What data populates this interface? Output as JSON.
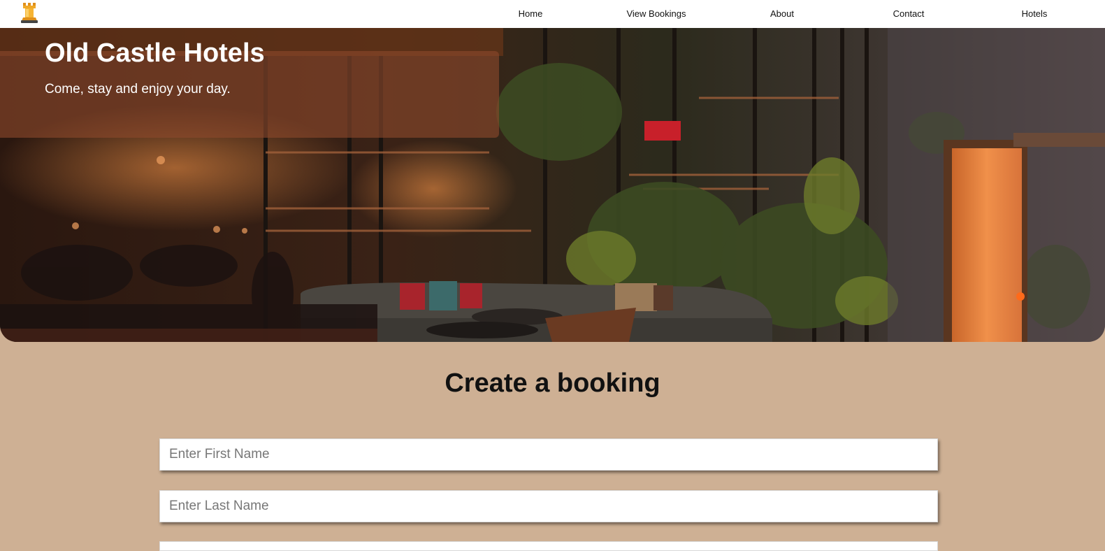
{
  "nav": {
    "logo_icon": "castle-tower-icon",
    "items": [
      {
        "label": "Home"
      },
      {
        "label": "View Bookings"
      },
      {
        "label": "About"
      },
      {
        "label": "Contact"
      },
      {
        "label": "Hotels"
      }
    ]
  },
  "hero": {
    "title": "Old Castle Hotels",
    "subtitle": "Come, stay and enjoy your day."
  },
  "booking": {
    "title": "Create a booking",
    "first_name": {
      "placeholder": "Enter First Name",
      "value": ""
    },
    "last_name": {
      "placeholder": "Enter Last Name",
      "value": ""
    }
  },
  "colors": {
    "page_background": "#ceb094",
    "nav_background": "#ffffff",
    "hero_overlay": "#8c482c"
  }
}
